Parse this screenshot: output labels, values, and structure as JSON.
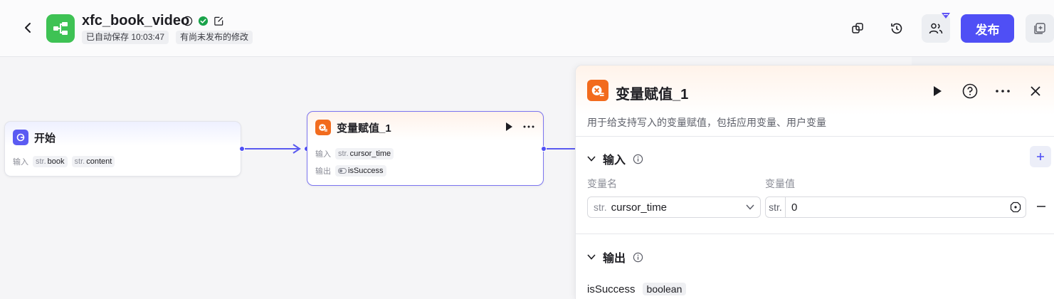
{
  "header": {
    "app_name": "xfc_book_video",
    "autosave": "已自动保存 10:03:47",
    "unpublished": "有尚未发布的修改",
    "publish_label": "发布"
  },
  "canvas": {
    "start_node": {
      "title": "开始",
      "input_label": "输入",
      "inputs": [
        {
          "type": "str.",
          "name": "book"
        },
        {
          "type": "str.",
          "name": "content"
        }
      ]
    },
    "var_node": {
      "title": "变量赋值_1",
      "input_label": "输入",
      "input": {
        "type": "str.",
        "name": "cursor_time"
      },
      "output_label": "输出",
      "output": {
        "name": "isSuccess"
      }
    }
  },
  "panel": {
    "title": "变量赋值_1",
    "description": "用于给支持写入的变量赋值，包括应用变量、用户变量",
    "input_section": "输入",
    "col_name": "变量名",
    "col_value": "变量值",
    "row": {
      "var_type": "str.",
      "var_name": "cursor_time",
      "value_type": "str.",
      "value": "0"
    },
    "output_section": "输出",
    "output": {
      "name": "isSuccess",
      "type": "boolean"
    }
  },
  "colors": {
    "accent": "#4f4ff5",
    "app_logo": "#3ec254",
    "node_icon_orange": "#f26b1d",
    "success_green": "#1aa34a"
  },
  "icons": [
    "back-icon",
    "app-logo-icon",
    "info-icon",
    "check-circle-icon",
    "edit-icon",
    "copy-icon",
    "history-icon",
    "users-icon",
    "expand-icon",
    "play-icon",
    "more-icon",
    "help-icon",
    "close-icon",
    "chevron-down-icon",
    "plus-icon",
    "minus-icon",
    "variable-icon"
  ]
}
